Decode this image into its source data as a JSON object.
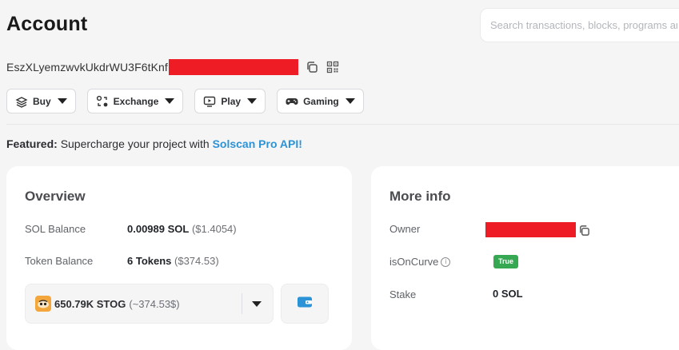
{
  "page": {
    "title": "Account",
    "search_placeholder": "Search transactions, blocks, programs and tokens"
  },
  "address": {
    "text": "EszXLyemzwvkUkdrWU3F6tKnf"
  },
  "actions": [
    {
      "label": "Buy",
      "icon": "layers-icon"
    },
    {
      "label": "Exchange",
      "icon": "exchange-icon"
    },
    {
      "label": "Play",
      "icon": "play-icon"
    },
    {
      "label": "Gaming",
      "icon": "gamepad-icon"
    }
  ],
  "featured": {
    "label": "Featured:",
    "text": "Supercharge your project with",
    "link": "Solscan Pro API!"
  },
  "overview": {
    "title": "Overview",
    "sol_balance_label": "SOL Balance",
    "sol_balance_value": "0.00989 SOL",
    "sol_balance_usd": "($1.4054)",
    "token_balance_label": "Token Balance",
    "token_balance_value": "6 Tokens",
    "token_balance_usd": "($374.53)",
    "token_select_value": "650.79K STOG",
    "token_select_usd": "(~374.53$)"
  },
  "more_info": {
    "title": "More info",
    "owner_label": "Owner",
    "is_on_curve_label": "isOnCurve",
    "is_on_curve_value": "True",
    "stake_label": "Stake",
    "stake_value": "0 SOL"
  },
  "colors": {
    "accent": "#2b93d6",
    "badge_green": "#36a852",
    "redaction": "#ee1c25",
    "wallet_icon": "#2b93d6",
    "token_icon": "#f3a63c"
  }
}
